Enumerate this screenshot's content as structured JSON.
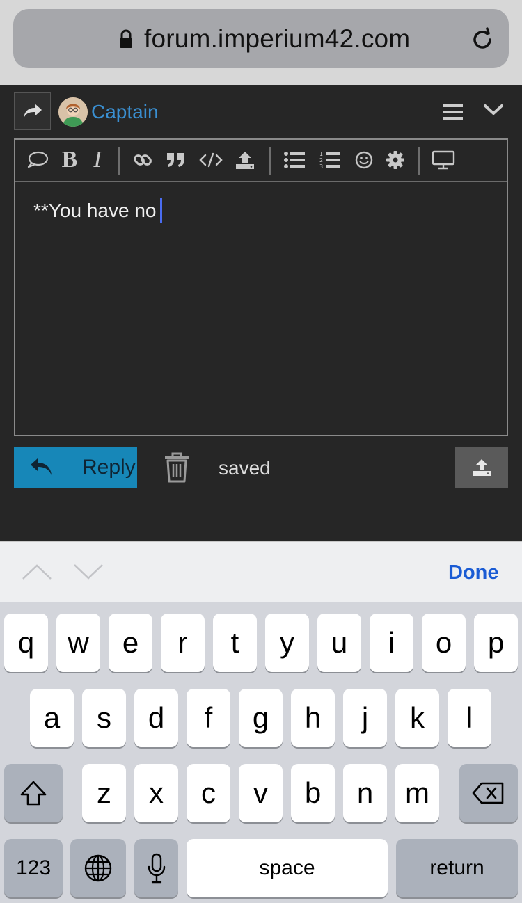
{
  "browser": {
    "url": "forum.imperium42.com"
  },
  "composer": {
    "username": "Captain",
    "editor_text": "**You have no",
    "toolbar_icons": [
      "speech-bubble-icon",
      "bold-icon",
      "italic-icon",
      "link-icon",
      "quote-icon",
      "code-icon",
      "upload-icon",
      "bullet-list-icon",
      "numbered-list-icon",
      "emoji-icon",
      "gear-icon",
      "preview-monitor-icon"
    ],
    "bold_glyph": "B",
    "italic_glyph": "I",
    "reply_label": "Reply",
    "status_text": "saved"
  },
  "accessory": {
    "done_label": "Done"
  },
  "keyboard": {
    "row1": [
      "q",
      "w",
      "e",
      "r",
      "t",
      "y",
      "u",
      "i",
      "o",
      "p"
    ],
    "row2": [
      "a",
      "s",
      "d",
      "f",
      "g",
      "h",
      "j",
      "k",
      "l"
    ],
    "row3": [
      "z",
      "x",
      "c",
      "v",
      "b",
      "n",
      "m"
    ],
    "numbers_label": "123",
    "space_label": "space",
    "return_label": "return"
  },
  "colors": {
    "accent": "#1787b8",
    "username": "#3a8fd1",
    "done": "#1a5bd4",
    "caret": "#4a6cf0"
  }
}
